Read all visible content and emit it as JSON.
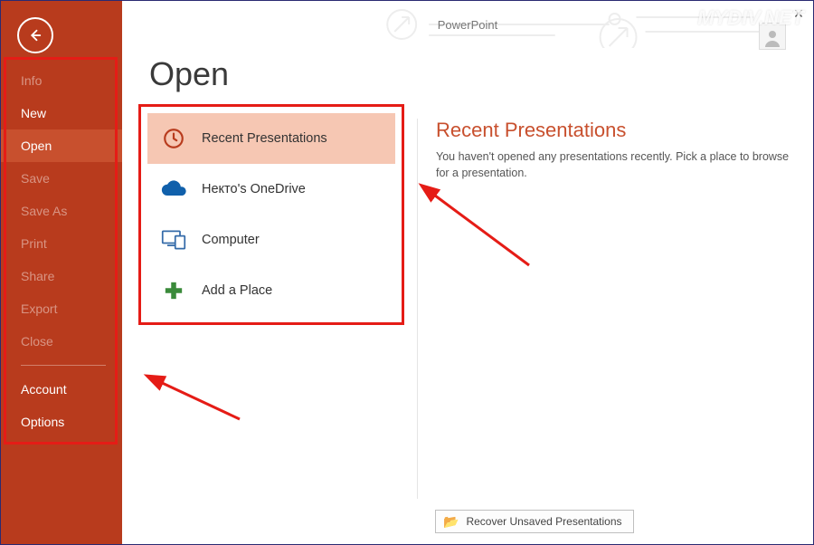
{
  "app_title": "PowerPoint",
  "watermark": "MYDIV.NET",
  "sidebar": {
    "items": [
      {
        "label": "Info",
        "state": "disabled"
      },
      {
        "label": "New",
        "state": "enabled"
      },
      {
        "label": "Open",
        "state": "selected"
      },
      {
        "label": "Save",
        "state": "disabled"
      },
      {
        "label": "Save As",
        "state": "disabled"
      },
      {
        "label": "Print",
        "state": "disabled"
      },
      {
        "label": "Share",
        "state": "disabled"
      },
      {
        "label": "Export",
        "state": "disabled"
      },
      {
        "label": "Close",
        "state": "disabled"
      }
    ],
    "footer": [
      {
        "label": "Account"
      },
      {
        "label": "Options"
      }
    ]
  },
  "page": {
    "title": "Open",
    "locations": [
      {
        "label": "Recent Presentations",
        "icon": "clock",
        "selected": true
      },
      {
        "label": "Некто's OneDrive",
        "icon": "onedrive",
        "selected": false
      },
      {
        "label": "Computer",
        "icon": "computer",
        "selected": false
      },
      {
        "label": "Add a Place",
        "icon": "plus",
        "selected": false
      }
    ],
    "right": {
      "heading": "Recent Presentations",
      "body": "You haven't opened any presentations recently. Pick a place to browse for a presentation."
    },
    "recover_label": "Recover Unsaved Presentations"
  }
}
